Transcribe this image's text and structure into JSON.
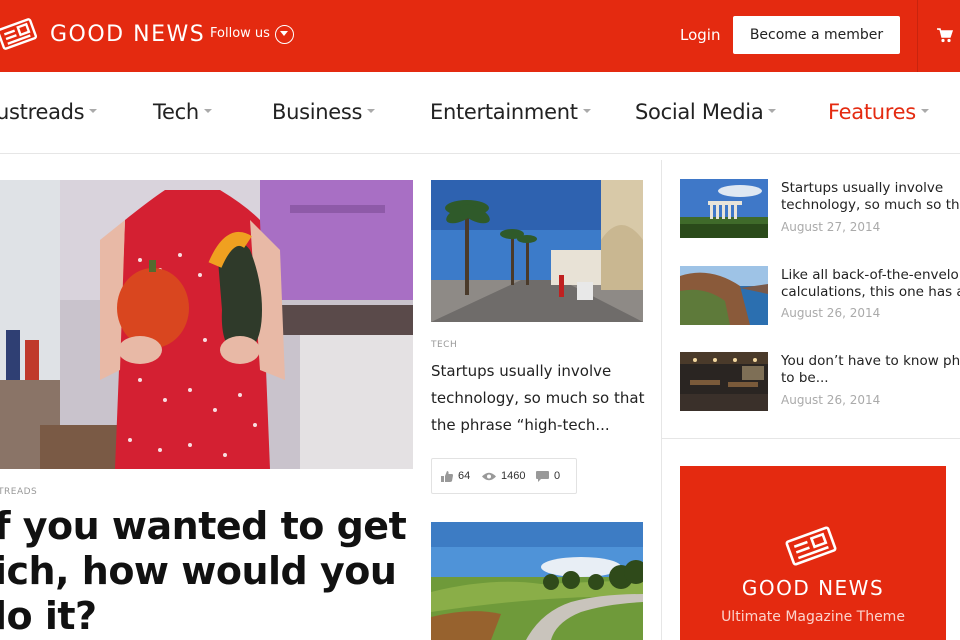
{
  "header": {
    "brand": "GOOD NEWS",
    "follow_label": "Follow us",
    "login_label": "Login",
    "member_button_label": "Become a member",
    "accent_color": "#e42a10"
  },
  "nav": {
    "items": [
      {
        "label": "ustreads"
      },
      {
        "label": "Tech"
      },
      {
        "label": "Business"
      },
      {
        "label": "Entertainment"
      },
      {
        "label": "Social Media"
      },
      {
        "label": "Features",
        "active": true
      }
    ]
  },
  "hero": {
    "category": "TREADS",
    "title": "f you wanted to get ich, how would you lo it?"
  },
  "mid_article": {
    "category": "TECH",
    "title": "Startups usually involve technology, so much so that the phrase “high-tech...",
    "likes": "64",
    "views": "1460",
    "comments": "0"
  },
  "sidebar": {
    "posts": [
      {
        "title_line1": "Startups usually involve",
        "title_line2": "technology, so much so that...",
        "date": "August 27, 2014"
      },
      {
        "title_line1": "Like all back-of-the-envelope",
        "title_line2": "calculations, this one has a...",
        "date": "August 26, 2014"
      },
      {
        "title_line1": "You don’t have to know phys",
        "title_line2": "to be...",
        "date": "August 26, 2014"
      }
    ]
  },
  "ad": {
    "brand": "GOOD NEWS",
    "subtitle": "Ultimate Magazine Theme"
  }
}
